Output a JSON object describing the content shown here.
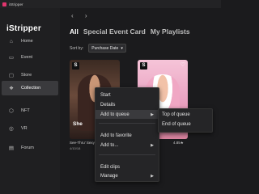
{
  "window": {
    "title": "iStripper"
  },
  "sidebar": {
    "logo": "iStripper",
    "items": [
      {
        "label": "Home",
        "icon": "home-icon",
        "glyph": "⌂"
      },
      {
        "label": "Event",
        "icon": "event-icon",
        "glyph": "▭"
      },
      {
        "label": "Store",
        "icon": "store-icon",
        "glyph": "▢"
      },
      {
        "label": "Collection",
        "icon": "collection-icon",
        "glyph": "❖",
        "active": true
      },
      {
        "label": "NFT",
        "icon": "nft-icon",
        "glyph": "⬡"
      },
      {
        "label": "VR",
        "icon": "vr-icon",
        "glyph": "◎"
      },
      {
        "label": "Forum",
        "icon": "forum-icon",
        "glyph": "▤"
      }
    ]
  },
  "topnav": {
    "back": "‹",
    "forward": "›"
  },
  "tabs": {
    "all": "All",
    "special": "Special Event Card",
    "playlists": "My Playlists"
  },
  "sort": {
    "label": "Sort by:",
    "value": "Purchase Date"
  },
  "cards": [
    {
      "badge": "S",
      "name": "She",
      "caption": "See-Thru' Sexy",
      "meta": "4/10/18"
    },
    {
      "badge": "S",
      "rating": "4.85★"
    }
  ],
  "context_menu": {
    "items": [
      "Start",
      "Details",
      "Add to queue",
      "Add to favorite",
      "Add to...",
      "Edit clips",
      "Manage"
    ],
    "highlighted": "Add to queue"
  },
  "submenu": {
    "items": [
      "Top of queue",
      "End of queue"
    ]
  },
  "colors": {
    "accent": "#e2356e",
    "sidebar_bg": "#1f1f21",
    "main_bg": "#1b1b1d",
    "menu_bg": "#252527"
  }
}
